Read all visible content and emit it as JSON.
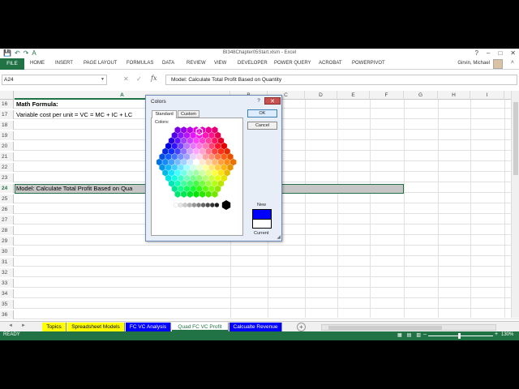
{
  "window": {
    "title": "BI348Chapter05Start.xlsm - Excel",
    "controls": {
      "help": "?",
      "minimize": "–",
      "maximize": "□",
      "close": "✕"
    }
  },
  "quick_access": {
    "save": "💾",
    "undo": "↶",
    "redo": "↷",
    "fill": "A"
  },
  "ribbon": {
    "file_label": "FILE",
    "tabs": [
      "HOME",
      "INSERT",
      "PAGE LAYOUT",
      "FORMULAS",
      "DATA",
      "REVIEW",
      "VIEW",
      "DEVELOPER",
      "POWER QUERY",
      "ACROBAT",
      "POWERPIVOT"
    ],
    "user": "Girvin, Michael",
    "collapse_icon": "˄"
  },
  "formula_bar": {
    "name_box": "A24",
    "name_box_arrow": "▼",
    "cancel_glyph": "✕",
    "enter_glyph": "✓",
    "fx_label": "fx",
    "formula": "Model: Calculate Total Profit Based on Quantity"
  },
  "grid": {
    "columns": [
      "A",
      "B",
      "C",
      "D",
      "E",
      "F",
      "G",
      "H",
      "I"
    ],
    "selected_column": "A",
    "selected_row": "24",
    "rows": [
      {
        "num": "16",
        "text": "Math Formula:",
        "bold": true
      },
      {
        "num": "17",
        "text": "Variable cost per unit = VC = MC + IC + LC",
        "bold": false
      },
      {
        "num": "18",
        "text": ""
      },
      {
        "num": "19",
        "text": ""
      },
      {
        "num": "20",
        "text": ""
      },
      {
        "num": "21",
        "text": ""
      },
      {
        "num": "22",
        "text": ""
      },
      {
        "num": "23",
        "text": ""
      },
      {
        "num": "24",
        "text": "Model: Calculate Total Profit Based on Qua",
        "bold": false
      },
      {
        "num": "25",
        "text": ""
      },
      {
        "num": "26",
        "text": ""
      },
      {
        "num": "27",
        "text": ""
      },
      {
        "num": "28",
        "text": ""
      },
      {
        "num": "29",
        "text": ""
      },
      {
        "num": "30",
        "text": ""
      },
      {
        "num": "31",
        "text": ""
      },
      {
        "num": "32",
        "text": ""
      },
      {
        "num": "33",
        "text": ""
      },
      {
        "num": "34",
        "text": ""
      },
      {
        "num": "35",
        "text": ""
      },
      {
        "num": "36",
        "text": ""
      }
    ]
  },
  "sheet_tabs": {
    "nav_prev": "◄",
    "nav_next": "►",
    "add_label": "+",
    "tabs": [
      {
        "label": "Topics",
        "color": "#ffff00",
        "text_color": "#000000"
      },
      {
        "label": "Spreadsheet Models",
        "color": "#ffff00",
        "text_color": "#000000"
      },
      {
        "label": "FC VC Analysis",
        "color": "#0000ff",
        "text_color": "#ffffff"
      },
      {
        "label": "Quad FC VC Profit",
        "color": "#0000ff",
        "text_color": "#217346",
        "active": true
      },
      {
        "label": "Calcualte Revenue",
        "color": "#0000ff",
        "text_color": "#ffffff"
      }
    ]
  },
  "status_bar": {
    "status": "READY",
    "view_icons": [
      "▦",
      "▤",
      "▥"
    ],
    "zoom_minus": "–",
    "zoom_plus": "+",
    "zoom": "130%"
  },
  "colors_dialog": {
    "title": "Colors",
    "help": "?",
    "close": "✕",
    "tabs": [
      "Standard",
      "Custom"
    ],
    "active_tab": "Standard",
    "colors_label": "Colors:",
    "ok_label": "OK",
    "cancel_label": "Cancel",
    "new_label": "New",
    "current_label": "Current",
    "new_color": "#0000ff",
    "current_color": "#ffffff"
  },
  "colors": {
    "accent": "#217346",
    "selection": "#c6c6c6"
  }
}
